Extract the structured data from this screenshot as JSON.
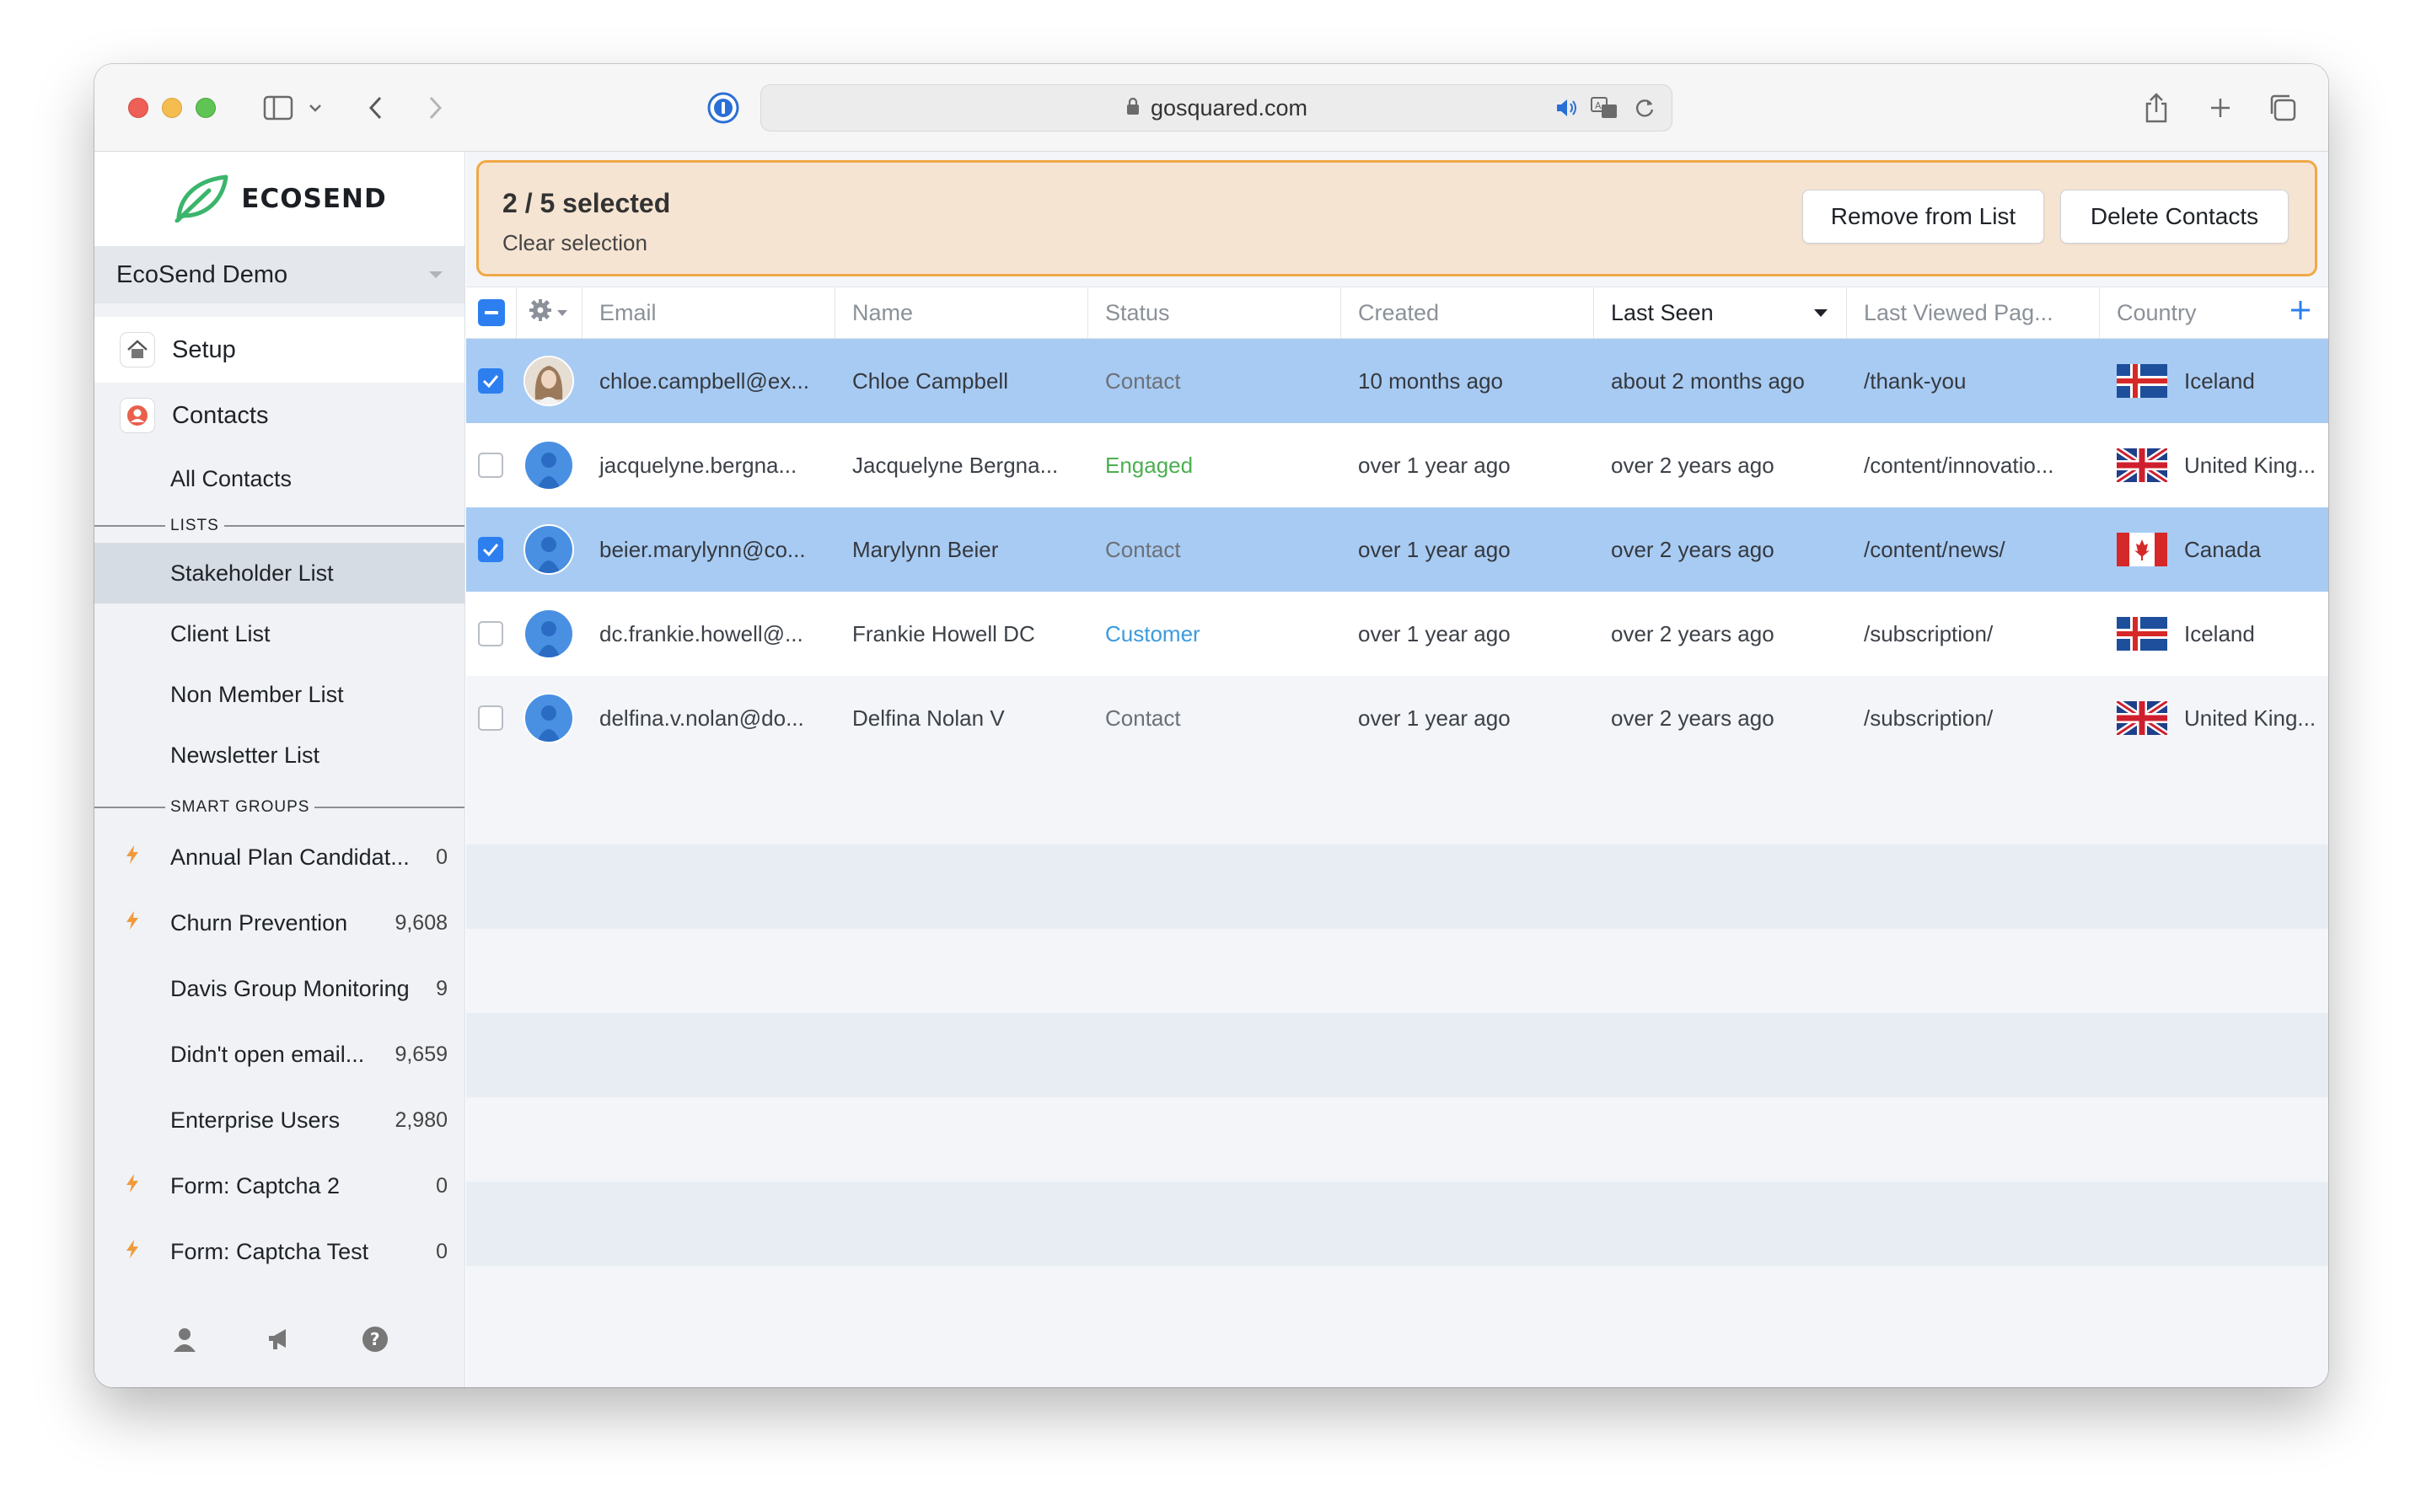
{
  "browser": {
    "url": "gosquared.com"
  },
  "app": {
    "logo_text": "ECOSEND",
    "account_name": "EcoSend Demo"
  },
  "sidebar": {
    "nav": [
      {
        "label": "Setup",
        "icon": "home-icon"
      },
      {
        "label": "Contacts",
        "icon": "contacts-icon"
      }
    ],
    "all_contacts": "All Contacts",
    "lists_header": "LISTS",
    "lists": [
      "Stakeholder List",
      "Client List",
      "Non Member List",
      "Newsletter List"
    ],
    "smart_groups_header": "SMART GROUPS",
    "smart_groups": [
      {
        "name": "Annual Plan Candidat...",
        "count": "0",
        "bolt": true
      },
      {
        "name": "Churn Prevention",
        "count": "9,608",
        "bolt": true
      },
      {
        "name": "Davis Group Monitoring",
        "count": "9",
        "bolt": false
      },
      {
        "name": "Didn't open email...",
        "count": "9,659",
        "bolt": false
      },
      {
        "name": "Enterprise Users",
        "count": "2,980",
        "bolt": false
      },
      {
        "name": "Form: Captcha 2",
        "count": "0",
        "bolt": true
      },
      {
        "name": "Form: Captcha Test",
        "count": "0",
        "bolt": true
      }
    ]
  },
  "selection": {
    "count_label": "2 / 5 selected",
    "clear_label": "Clear selection",
    "remove_button": "Remove from List",
    "delete_button": "Delete Contacts",
    "banner_border_color": "#f0a847",
    "banner_bg_color": "#f6e4d3"
  },
  "table": {
    "columns": [
      "Email",
      "Name",
      "Status",
      "Created",
      "Last Seen",
      "Last Viewed Pag...",
      "Country"
    ],
    "sorted_column": "Last Seen",
    "rows": [
      {
        "selected": true,
        "avatar": "photo",
        "email": "chloe.campbell@ex...",
        "name": "Chloe Campbell",
        "status": "Contact",
        "created": "10 months ago",
        "last_seen": "about 2 months ago",
        "last_page": "/thank-you",
        "country": "Iceland",
        "flag": "iceland"
      },
      {
        "selected": false,
        "avatar": "default",
        "email": "jacquelyne.bergna...",
        "name": "Jacquelyne Bergna...",
        "status": "Engaged",
        "created": "over 1 year ago",
        "last_seen": "over 2 years ago",
        "last_page": "/content/innovatio...",
        "country": "United King...",
        "flag": "uk"
      },
      {
        "selected": true,
        "avatar": "default",
        "email": "beier.marylynn@co...",
        "name": "Marylynn Beier",
        "status": "Contact",
        "created": "over 1 year ago",
        "last_seen": "over 2 years ago",
        "last_page": "/content/news/",
        "country": "Canada",
        "flag": "canada"
      },
      {
        "selected": false,
        "avatar": "default",
        "email": "dc.frankie.howell@...",
        "name": "Frankie Howell DC",
        "status": "Customer",
        "created": "over 1 year ago",
        "last_seen": "over 2 years ago",
        "last_page": "/subscription/",
        "country": "Iceland",
        "flag": "iceland"
      },
      {
        "selected": false,
        "avatar": "default",
        "email": "delfina.v.nolan@do...",
        "name": "Delfina Nolan V",
        "status": "Contact",
        "created": "over 1 year ago",
        "last_seen": "over 2 years ago",
        "last_page": "/subscription/",
        "country": "United King...",
        "flag": "uk"
      }
    ],
    "status_colors": {
      "Contact": "#6b7178",
      "Engaged": "#4caf50",
      "Customer": "#3a9be0"
    },
    "selected_row_color": "#a8cbf3"
  }
}
